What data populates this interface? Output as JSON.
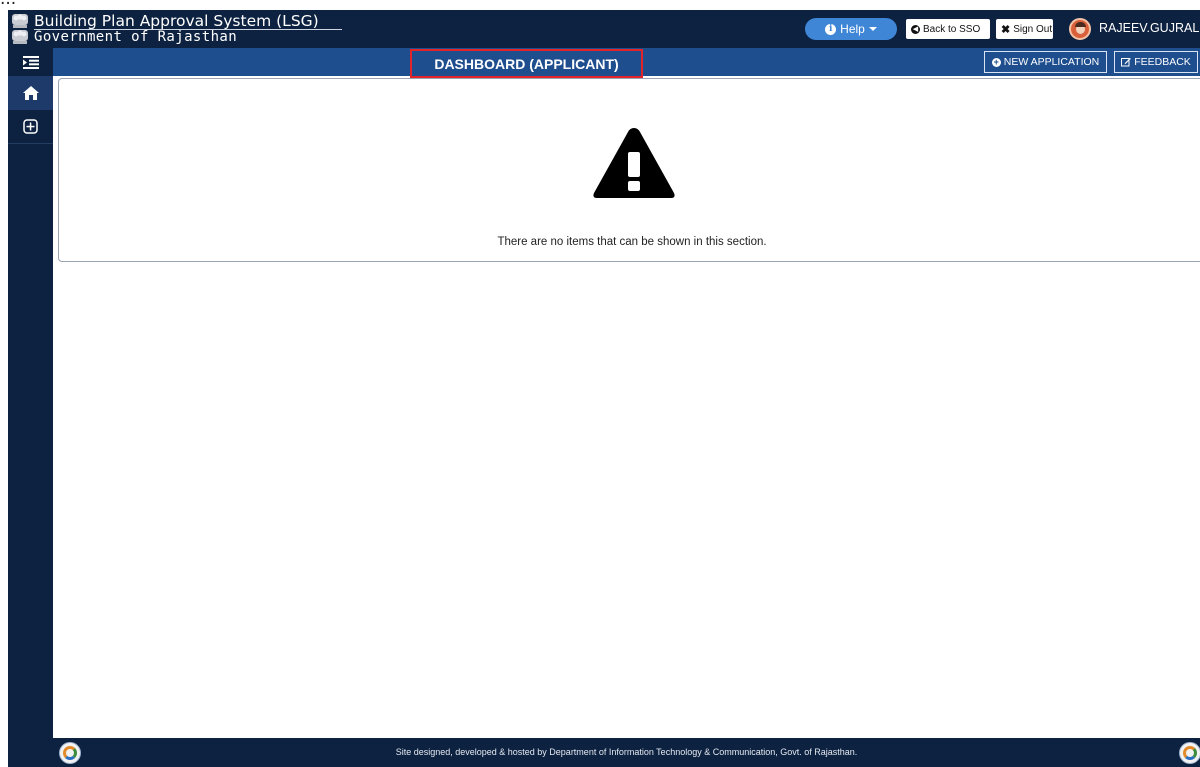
{
  "top_strip_text": "...",
  "app": {
    "title": "Building Plan Approval System (LSG)",
    "subtitle": "Government of Rajasthan"
  },
  "header": {
    "help_label": "Help",
    "back_to_sso_label": "Back to SSO",
    "sign_out_label": "Sign Out",
    "username": "RAJEEV.GUJRAL"
  },
  "sidebar": {
    "items": [
      {
        "icon": "menu-toggle-icon"
      },
      {
        "icon": "home-icon",
        "active": true
      },
      {
        "icon": "plus-square-icon"
      }
    ]
  },
  "subheader": {
    "page_title": "DASHBOARD (APPLICANT)",
    "new_application_label": "NEW APPLICATION",
    "feedback_label": "FEEDBACK"
  },
  "main": {
    "empty_icon": "warning-icon",
    "empty_message": "There are no items that can be shown in this section."
  },
  "footer": {
    "text": "Site designed, developed & hosted by Department of Information Technology & Communication, Govt. of Rajasthan."
  },
  "colors": {
    "header_bg": "#0d2240",
    "subheader_bg": "#1f4e8e",
    "help_button": "#3f86d6",
    "title_highlight_border": "#e3232a"
  }
}
